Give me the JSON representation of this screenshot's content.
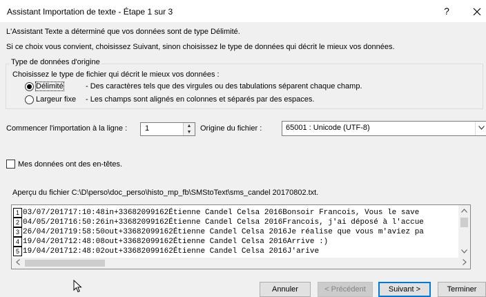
{
  "window": {
    "title": "Assistant Importation de texte - Étape 1 sur 3",
    "help_label": "?",
    "close_label": "✕"
  },
  "intro": {
    "line1": "L'Assistant Texte a déterminé que vos données sont de type Délimité.",
    "line2": "Si ce choix vous convient, choisissez Suivant, sinon choisissez le type de données qui décrit le mieux vos données."
  },
  "data_type_group": {
    "legend": "Type de données d'origine",
    "prompt": "Choisissez le type de fichier qui décrit le mieux vos données :",
    "options": [
      {
        "label": "Délimité",
        "description": "- Des caractères tels que des virgules ou des tabulations séparent chaque champ.",
        "selected": true
      },
      {
        "label": "Largeur fixe",
        "description": "- Les champs sont alignés en colonnes et séparés par des espaces.",
        "selected": false
      }
    ]
  },
  "start_row": {
    "label": "Commencer l'importation à la ligne :",
    "value": "1"
  },
  "file_origin": {
    "label": "Origine du fichier :",
    "value": "65001 : Unicode (UTF-8)"
  },
  "headers_checkbox": {
    "label": "Mes données ont des en-têtes.",
    "checked": false
  },
  "preview": {
    "caption": "Aperçu du fichier C:\\D\\perso\\doc_perso\\histo_mp_fb\\SMStoText\\sms_candel 20170802.txt.",
    "rows": [
      {
        "num": "1",
        "text": "03/07/201717:10:48in+33682099162Étienne Candel Celsa 2016Bonsoir Francois,  Vous le save"
      },
      {
        "num": "2",
        "text": "04/05/201716:50:26in+33682099162Étienne Candel Celsa 2016Francois, j'ai déposé à l'accue"
      },
      {
        "num": "3",
        "text": "26/04/201719:58:50out+33682099162Étienne Candel Celsa 2016Je réalise que vous m'aviez pa"
      },
      {
        "num": "4",
        "text": "19/04/201712:48:08out+33682099162Étienne Candel Celsa 2016Arrive :)"
      },
      {
        "num": "5",
        "text": "19/04/201712:48:02out+33682099162Étienne Candel Celsa 2016J'arive"
      }
    ]
  },
  "buttons": {
    "cancel": "Annuler",
    "previous": "< Précédent",
    "next": "Suivant >",
    "finish": "Terminer"
  },
  "colors": {
    "accent": "#0078d7",
    "dialog_bg": "#f0f0f0"
  }
}
